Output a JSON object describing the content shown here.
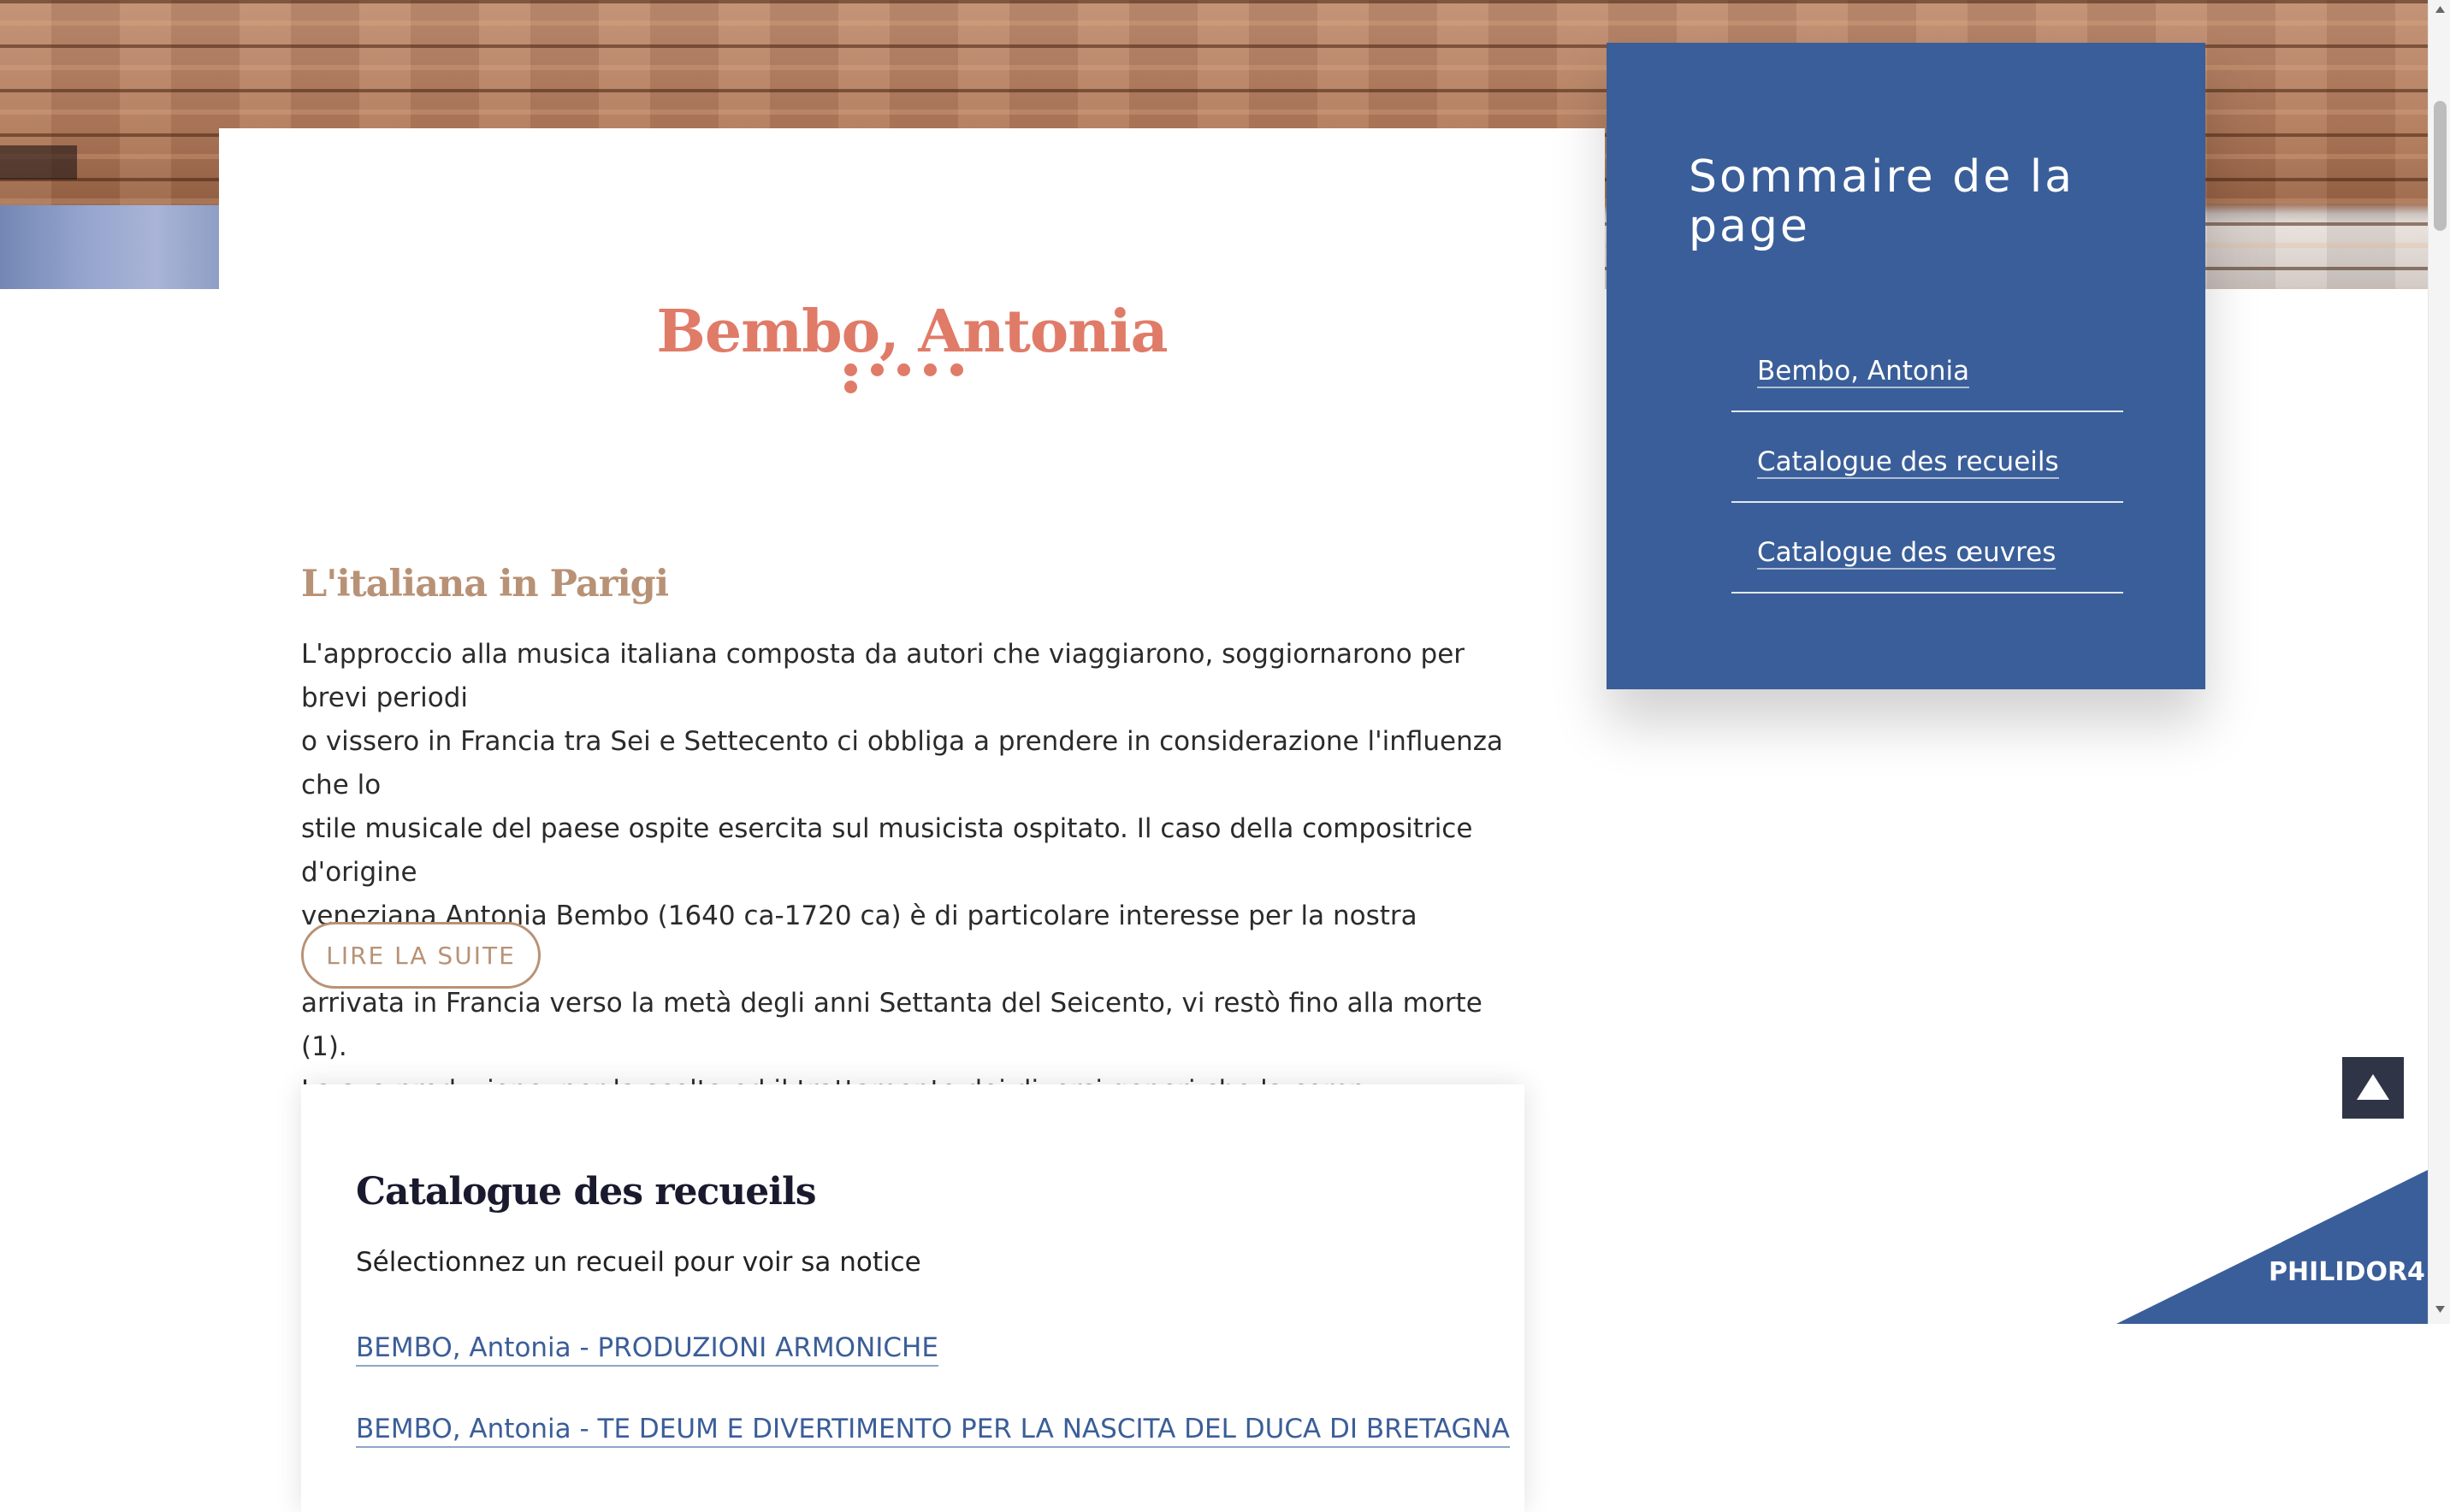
{
  "page": {
    "title": "Bembo, Antonia",
    "section_title": "L'italiana in Parigi",
    "intro_lines": [
      "L'approccio alla musica italiana composta da autori che viaggiarono, soggiornarono per brevi periodi",
      "o vissero in Francia tra Sei e Settecento ci obbliga a prendere in considerazione l'influenza che lo",
      "stile musicale del paese ospite esercita sul musicista ospitato. Il caso della compositrice d'origine",
      "veneziana Antonia Bembo (1640 ca-1720 ca) è di particolare interesse per la nostra indagine:",
      "arrivata in Francia verso la metà degli anni Settanta del Seicento, vi restò fino alla morte (1).",
      "La sua produzione, per la scelta ed il trattamento dei diversi generi che la comp..."
    ],
    "read_more_label": "LIRE LA SUITE"
  },
  "catalogue": {
    "title": "Catalogue des recueils",
    "subtitle": "Sélectionnez un recueil pour voir sa notice",
    "links": [
      "BEMBO, Antonia - PRODUZIONI ARMONICHE",
      "BEMBO, Antonia - TE DEUM E DIVERTIMENTO PER LA NASCITA DEL DUCA DI BRETAGNA"
    ]
  },
  "toc": {
    "title": "Sommaire de la page",
    "items": [
      "Bembo, Antonia",
      "Catalogue des recueils",
      "Catalogue des œuvres"
    ]
  },
  "brand": {
    "label": "PHILIDOR4"
  },
  "colors": {
    "accent_salmon": "#e07b68",
    "accent_tan": "#b89276",
    "toc_blue": "#3a5e99",
    "link_blue": "#3b5e98",
    "dark_button": "#2f3446"
  },
  "icons": {
    "to_top": "triangle-up-icon",
    "scroll_up": "caret-up-icon",
    "scroll_down": "caret-down-icon"
  }
}
